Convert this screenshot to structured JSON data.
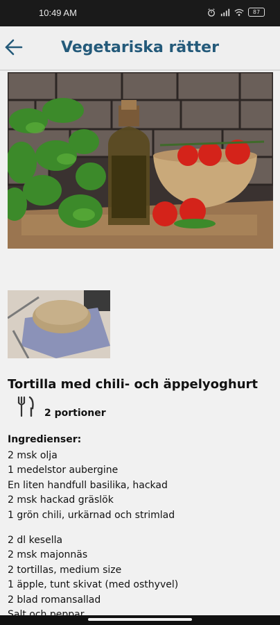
{
  "status_bar": {
    "time": "10:49 AM",
    "battery": "87",
    "icons": [
      "alarm-icon",
      "signal-icon",
      "wifi-icon",
      "battery-icon"
    ]
  },
  "app_bar": {
    "title": "Vegetariska rätter",
    "back_icon": "arrow-left-icon"
  },
  "recipe": {
    "title": "Tortilla med chili- och äppelyoghurt",
    "servings_icon": "fork-knife-icon",
    "servings": "2 portioner",
    "ingredients_heading": "Ingredienser:",
    "ingredients_group1": [
      "2 msk olja",
      "1 medelstor aubergine",
      "En liten handfull basilika, hackad",
      "2 msk hackad gräslök",
      "1 grön chili, urkärnad och strimlad"
    ],
    "ingredients_group2": [
      "2 dl kesella",
      "2 msk majonnäs",
      "2 tortillas, medium size",
      "1 äpple, tunt skivat (med osthyvel)",
      "2 blad romansallad",
      "Salt och peppar"
    ]
  },
  "colors": {
    "accent": "#245a7a",
    "background": "#f1f1f1",
    "status_bar": "#1a1a1a"
  }
}
